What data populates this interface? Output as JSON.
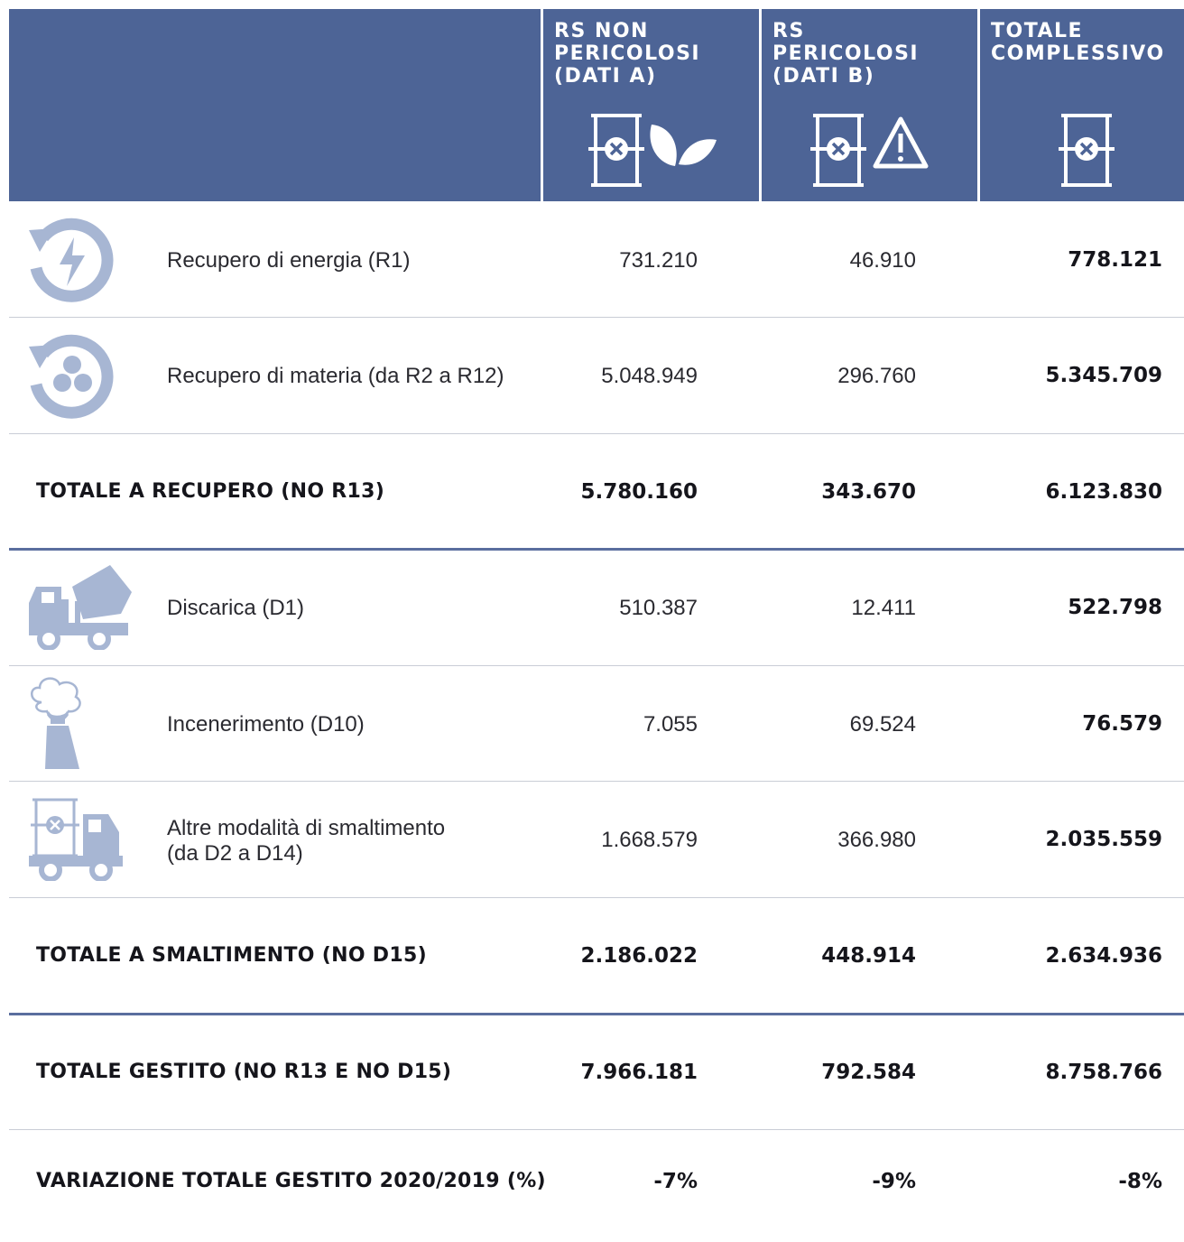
{
  "header": {
    "col1": "RS NON\nPERICOLOSI\n(DATI A)",
    "col2": "RS\nPERICOLOSI\n(DATI B)",
    "col3": "TOTALE\nCOMPLESSIVO"
  },
  "rows": [
    {
      "label": "Recupero di energia (R1)",
      "a": "731.210",
      "b": "46.910",
      "tot": "778.121"
    },
    {
      "label": "Recupero di materia (da R2 a R12)",
      "a": "5.048.949",
      "b": "296.760",
      "tot": "5.345.709"
    },
    {
      "label": "TOTALE A RECUPERO (NO R13)",
      "a": "5.780.160",
      "b": "343.670",
      "tot": "6.123.830"
    },
    {
      "label": "Discarica (D1)",
      "a": "510.387",
      "b": "12.411",
      "tot": "522.798"
    },
    {
      "label": "Incenerimento (D10)",
      "a": "7.055",
      "b": "69.524",
      "tot": "76.579"
    },
    {
      "label": "Altre modalità di smaltimento\n(da D2 a D14)",
      "a": "1.668.579",
      "b": "366.980",
      "tot": "2.035.559"
    },
    {
      "label": "TOTALE A SMALTIMENTO (NO D15)",
      "a": "2.186.022",
      "b": "448.914",
      "tot": "2.634.936"
    },
    {
      "label": "TOTALE GESTITO (NO R13 E NO D15)",
      "a": "7.966.181",
      "b": "792.584",
      "tot": "8.758.766"
    },
    {
      "label": "VARIAZIONE TOTALE GESTITO 2020/2019 (%)",
      "a": "-7%",
      "b": "-9%",
      "tot": "-8%"
    }
  ],
  "colors": {
    "header_bg": "#4d6496",
    "icon": "#a7b6d3",
    "separator_blue": "#5a6e9e"
  },
  "icons": [
    "barrel-leaf-icon",
    "barrel-warning-icon",
    "barrel-icon",
    "energy-recovery-icon",
    "material-recovery-icon",
    "landfill-truck-icon",
    "incinerator-icon",
    "barrel-truck-icon"
  ]
}
